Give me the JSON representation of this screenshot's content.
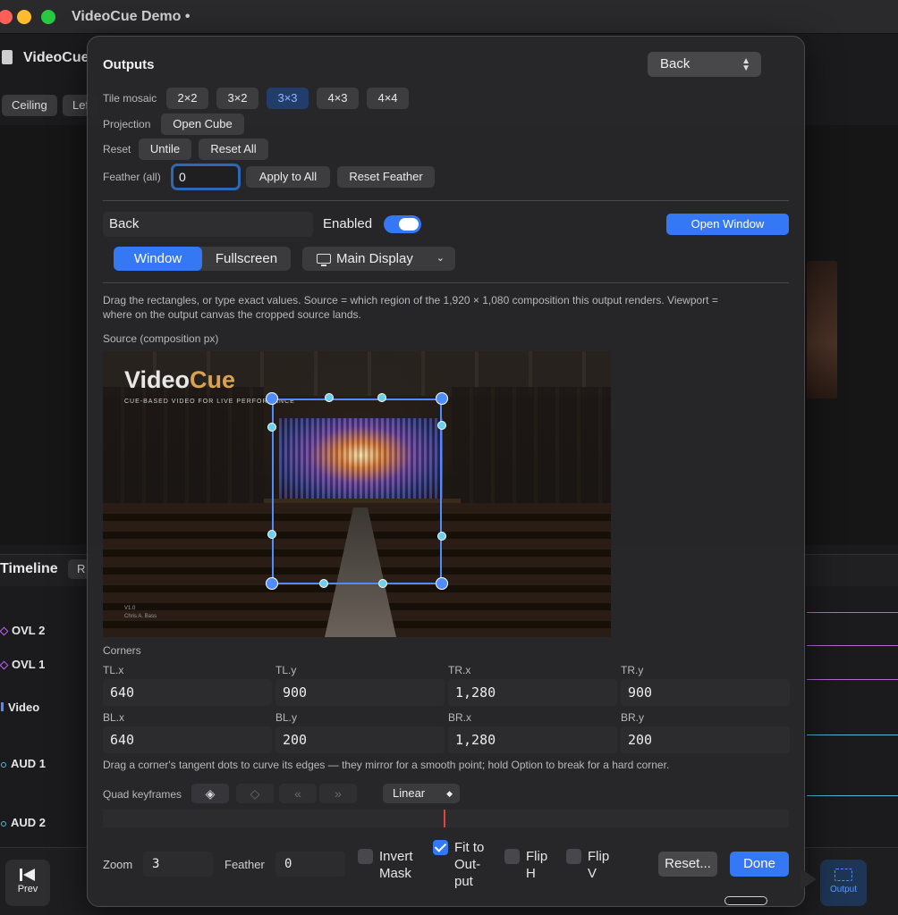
{
  "app": {
    "window_title": "VideoCue Demo •",
    "doc_title": "VideoCue",
    "bg_chips": [
      "Ceiling",
      "Lef"
    ],
    "timeline_label": "Timeline",
    "timeline_chip": "R",
    "tracks": [
      "OVL 2",
      "OVL 1",
      "Video",
      "AUD 1",
      "AUD 2"
    ],
    "prev_label": "Prev",
    "output_label": "Output"
  },
  "outputs": {
    "title": "Outputs",
    "output_select": "Back",
    "tile_mosaic": {
      "label": "Tile mosaic",
      "options": [
        "2×2",
        "3×2",
        "3×3",
        "4×3",
        "4×4"
      ],
      "selected": "3×3"
    },
    "projection": {
      "label": "Projection",
      "button": "Open Cube"
    },
    "reset": {
      "label": "Reset",
      "untile": "Untile",
      "reset_all": "Reset All"
    },
    "feather_all": {
      "label": "Feather (all)",
      "value": "0",
      "apply": "Apply to All",
      "reset": "Reset Feather"
    }
  },
  "output_detail": {
    "name": "Back",
    "enabled_label": "Enabled",
    "enabled": true,
    "open_window": "Open Window",
    "mode_window": "Window",
    "mode_fullscreen": "Fullscreen",
    "display": "Main Display",
    "help_line1": "Drag the rectangles, or type exact values. Source = which region of the 1,920 × 1,080 composition this output renders. Viewport =",
    "help_line2": "where on the output canvas the cropped source lands.",
    "source_label": "Source (composition px)",
    "preview": {
      "logo_video": "Video",
      "logo_cue": "Cue",
      "logo_sub": "CUE-BASED VIDEO FOR LIVE PERFORMANCE",
      "version": "V1.0",
      "author": "Chris A. Bass"
    }
  },
  "corners": {
    "title": "Corners",
    "tl_x": {
      "label": "TL.x",
      "value": "640"
    },
    "tl_y": {
      "label": "TL.y",
      "value": "900"
    },
    "tr_x": {
      "label": "TR.x",
      "value": "1,280"
    },
    "tr_y": {
      "label": "TR.y",
      "value": "900"
    },
    "bl_x": {
      "label": "BL.x",
      "value": "640"
    },
    "bl_y": {
      "label": "BL.y",
      "value": "200"
    },
    "br_x": {
      "label": "BR.x",
      "value": "1,280"
    },
    "br_y": {
      "label": "BR.y",
      "value": "200"
    },
    "help": "Drag a corner's tangent dots to curve its edges — they mirror for a smooth point; hold Option to break for a hard corner."
  },
  "keyframes": {
    "label": "Quad keyframes",
    "interpolation": "Linear"
  },
  "footer": {
    "zoom_label": "Zoom",
    "zoom_value": "3",
    "feather_label": "Feather",
    "feather_value": "0",
    "invert_mask": {
      "line1": "Invert",
      "line2": "Mask",
      "checked": false
    },
    "fit_to_output": {
      "line1": "Fit to",
      "line2": "Out-",
      "line3": "put",
      "checked": true
    },
    "flip_h": {
      "line1": "Flip",
      "line2": "H",
      "checked": false
    },
    "flip_v": {
      "line1": "Flip",
      "line2": "V",
      "checked": false
    },
    "reset": "Reset...",
    "done": "Done"
  },
  "colors": {
    "accent": "#3478f6",
    "selection": "#4e8cff",
    "tangent": "#6ad0f0",
    "playhead": "#e0453b"
  }
}
